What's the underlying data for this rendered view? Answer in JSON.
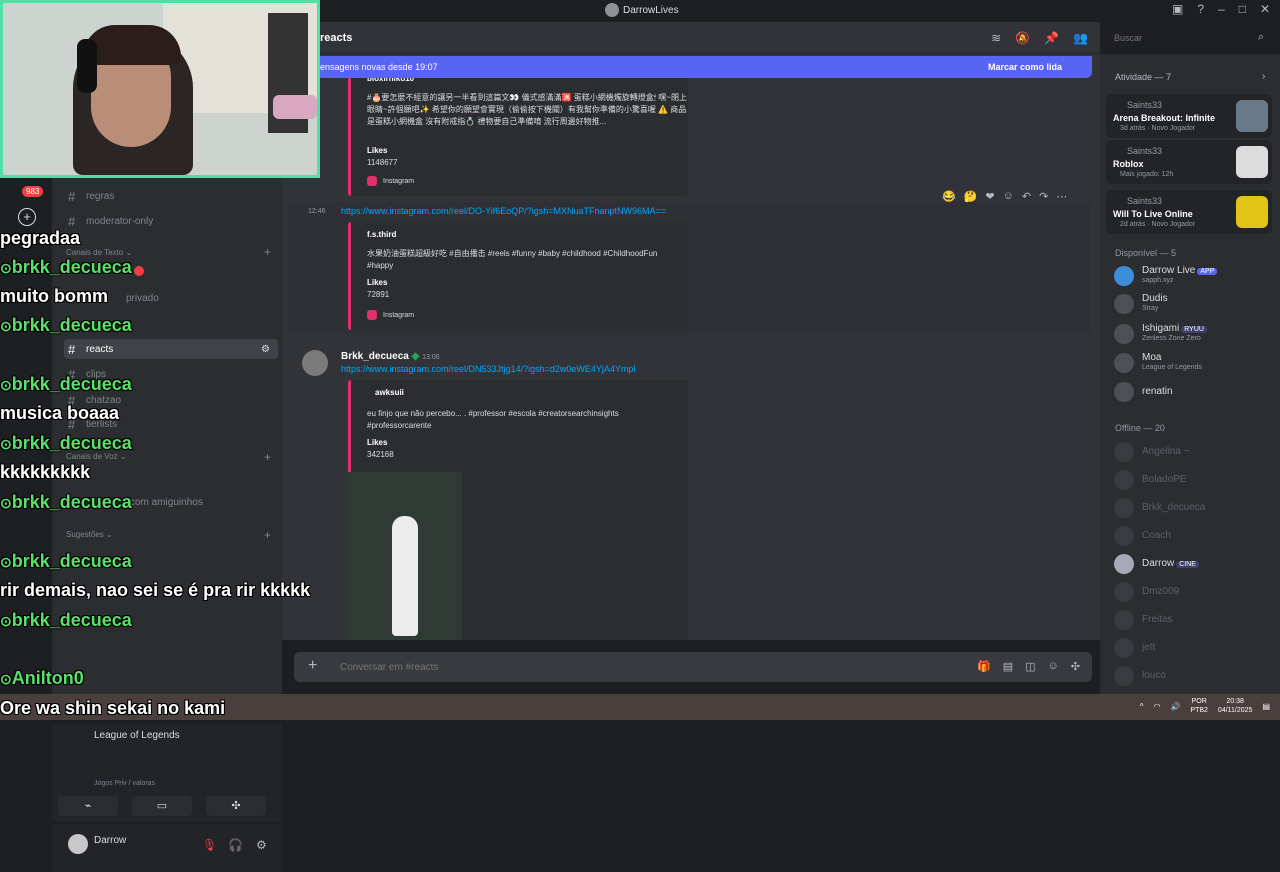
{
  "window": {
    "title": "DarrowLives"
  },
  "header": {
    "channel": "reacts"
  },
  "search": {
    "placeholder": "Buscar"
  },
  "new_messages": {
    "text": "ensagens novas desde 19:07",
    "action": "Marcar como lida"
  },
  "guilds": {
    "badge": "983"
  },
  "channels": {
    "items": [
      {
        "label": "regras"
      },
      {
        "label": "moderator-only"
      },
      {
        "label": "privado"
      },
      {
        "label": "reacts"
      },
      {
        "label": "clips"
      },
      {
        "label": "chatzao"
      },
      {
        "label": "tierlists"
      },
      {
        "label": "com amiguinhos"
      }
    ],
    "categories": {
      "text": "Canais de Texto",
      "voice": "Canais de Voz",
      "suggestions": "Sugestões"
    },
    "voice_panel": {
      "title": "League of Legends",
      "subtitle": "Jogos Priv / valoras"
    },
    "user": {
      "name": "Darrow"
    }
  },
  "messages": {
    "embed1": {
      "author": "bloxirniko10",
      "description": "#🎂要怎麼不經意的讓另一半看到這篇文👀 儀式感滿滿🈵 蛋糕小網機燭旋轉燈盒🕯 嘿~閉上眼睛~許個願吧✨ 希望你的願望會實現（偷偷按下機關）有我幫你準備的小驚喜喔 ⚠️ 商品是蛋糕小網機盒 沒有附戒指💍 禮物要自己準備唷 流行周邊好物推...",
      "likes_label": "Likes",
      "likes": "1148677",
      "footer": "Instagram"
    },
    "msg2": {
      "time": "12:46",
      "link": "https://www.instagram.com/reel/DO-Yif6EoQP/?igsh=MXNuaTFnanptNW96MA==",
      "embed": {
        "author": "f.s.third",
        "description": "水果奶油蛋糕超級好吃 #自由播击 #reels #funny #baby #childhood #ChildhoodFun #happy",
        "likes_label": "Likes",
        "likes": "72891",
        "footer": "Instagram"
      }
    },
    "msg3": {
      "author": "Brkk_decueca",
      "time": "13:06",
      "link": "https://www.instagram.com/reel/DN533Jtjg14/?igsh=d2w0eWE4YjA4Ympl",
      "embed": {
        "author": "awksuii",
        "description": "eu finjo que não percebo... . #professor #escola #creatorsearchinsights #professorcarente",
        "likes_label": "Likes",
        "likes": "342168"
      }
    }
  },
  "input": {
    "placeholder": "Conversar em #reacts"
  },
  "members": {
    "activity_title": "Atividade — 7",
    "activities": [
      {
        "user": "Saints33",
        "game": "Arena Breakout: Infinite",
        "meta": "3d atrás · Novo Jogador"
      },
      {
        "user": "Saints33",
        "game": "Roblox",
        "meta": "Mais jogado: 12h"
      },
      {
        "user": "Saints33",
        "game": "Will To Live Online",
        "meta": "2d atrás · Novo Jogador"
      }
    ],
    "online_title": "Disponível — 5",
    "online": [
      {
        "name": "Darrow Live",
        "tag": "APP",
        "status": "sapph.xyz"
      },
      {
        "name": "Dudis",
        "status": "Stray"
      },
      {
        "name": "Ishigami",
        "tag": "RYUU",
        "status": "Zenless Zone Zero"
      },
      {
        "name": "Moa",
        "status": "League of Legends"
      },
      {
        "name": "renatin",
        "status": ""
      }
    ],
    "offline_title": "Offline — 20",
    "offline": [
      {
        "name": "Angelina ~"
      },
      {
        "name": "BoladoPE"
      },
      {
        "name": "Brkk_decueca"
      },
      {
        "name": "Coach"
      },
      {
        "name": "Darrow",
        "tag": "CINE"
      },
      {
        "name": "Dmz009"
      },
      {
        "name": "Freitas"
      },
      {
        "name": "jett"
      },
      {
        "name": "louco"
      }
    ]
  },
  "overlay_chat": [
    {
      "text": "pegradaa",
      "user": false
    },
    {
      "text": "brkk_decueca",
      "user": true
    },
    {
      "text": "muito bomm",
      "user": false
    },
    {
      "text": "brkk_decueca",
      "user": true
    },
    {
      "text": "brkk_decueca",
      "user": true
    },
    {
      "text": "musica boaaa",
      "user": false
    },
    {
      "text": "brkk_decueca",
      "user": true
    },
    {
      "text": "kkkkkkkkk",
      "user": false
    },
    {
      "text": "brkk_decueca",
      "user": true
    },
    {
      "text": "brkk_decueca",
      "user": true
    },
    {
      "text": "rir demais, nao sei se é pra rir kkkkk",
      "user": false
    },
    {
      "text": "brkk_decueca",
      "user": true
    },
    {
      "text": "Anilton0",
      "user": true
    },
    {
      "text": "Ore wa shin sekai no kami",
      "user": false
    }
  ],
  "taskbar": {
    "lang1": "POR",
    "lang2": "PTB2",
    "time": "20:38",
    "date": "04/11/2025"
  },
  "colors": {
    "accent": "#5865f2",
    "overlay_user": "#58e26a",
    "cam_border": "#4fe0a6",
    "instagram": "#e1306c"
  }
}
